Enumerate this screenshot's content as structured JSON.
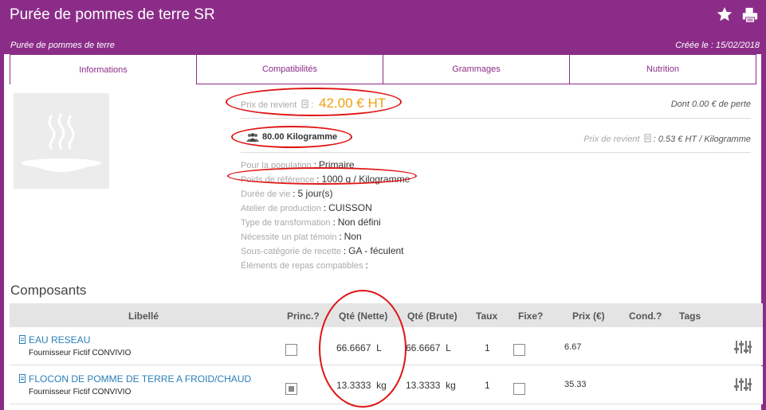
{
  "header": {
    "title": "Purée de pommes de terre SR",
    "subtitle": "Purée de pommes de terre",
    "created_label": "Créée le : 15/02/2018"
  },
  "tabs": [
    {
      "label": "Informations",
      "active": true
    },
    {
      "label": "Compatibilités",
      "active": false
    },
    {
      "label": "Grammages",
      "active": false
    },
    {
      "label": "Nutrition",
      "active": false
    }
  ],
  "cost": {
    "label": "Prix de revient",
    "value": "42.00  € HT",
    "perte": "Dont 0.00 € de perte"
  },
  "quantity": {
    "value": "80.00 Kilogramme",
    "unit_cost_label": "Prix de revient",
    "unit_cost_value": "0.53 € HT / Kilogramme"
  },
  "properties": [
    {
      "label": "Pour la population",
      "value": "Primaire"
    },
    {
      "label": "Poids de référence",
      "value": "1000 g / Kilogramme"
    },
    {
      "label": "Durée de vie",
      "value": "5 jour(s)"
    },
    {
      "label": "Atelier de production",
      "value": "CUISSON"
    },
    {
      "label": "Type de transformation",
      "value": "Non défini"
    },
    {
      "label": "Nécessite un plat témoin",
      "value": "Non"
    },
    {
      "label": "Sous-catégorie de recette",
      "value": "GA - féculent"
    },
    {
      "label": "Éléments de repas compatibles",
      "value": ""
    }
  ],
  "composants": {
    "title": "Composants",
    "columns": [
      "Libellé",
      "Princ.?",
      "Qté (Nette)",
      "Qté (Brute)",
      "Taux",
      "Fixe?",
      "Prix (€)",
      "Cond.?",
      "Tags"
    ],
    "rows": [
      {
        "name": "EAU RESEAU",
        "supplier": "Fournisseur Fictif CONVIVIO",
        "princ": false,
        "qte_nette": "66.6667",
        "unit_nette": "L",
        "qte_brute": "66.6667",
        "unit_brute": "L",
        "taux": "1",
        "fixe": false,
        "prix": "6.67"
      },
      {
        "name": "FLOCON DE POMME DE TERRE A FROID/CHAUD",
        "supplier": "Fournisseur Fictif CONVIVIO",
        "princ": true,
        "qte_nette": "13.3333",
        "unit_nette": "kg",
        "qte_brute": "13.3333",
        "unit_brute": "kg",
        "taux": "1",
        "fixe": false,
        "prix": "35.33"
      }
    ]
  },
  "colors": {
    "brand": "#8b2d88",
    "cost": "#f0a010",
    "link": "#2a7fb8",
    "annotation": "#e01515"
  },
  "icons": {
    "favorite": "star-icon",
    "print": "print-icon",
    "recipe_placeholder": "steaming-plate-icon",
    "people": "people-icon",
    "document": "document-icon",
    "settings": "sliders-icon"
  }
}
